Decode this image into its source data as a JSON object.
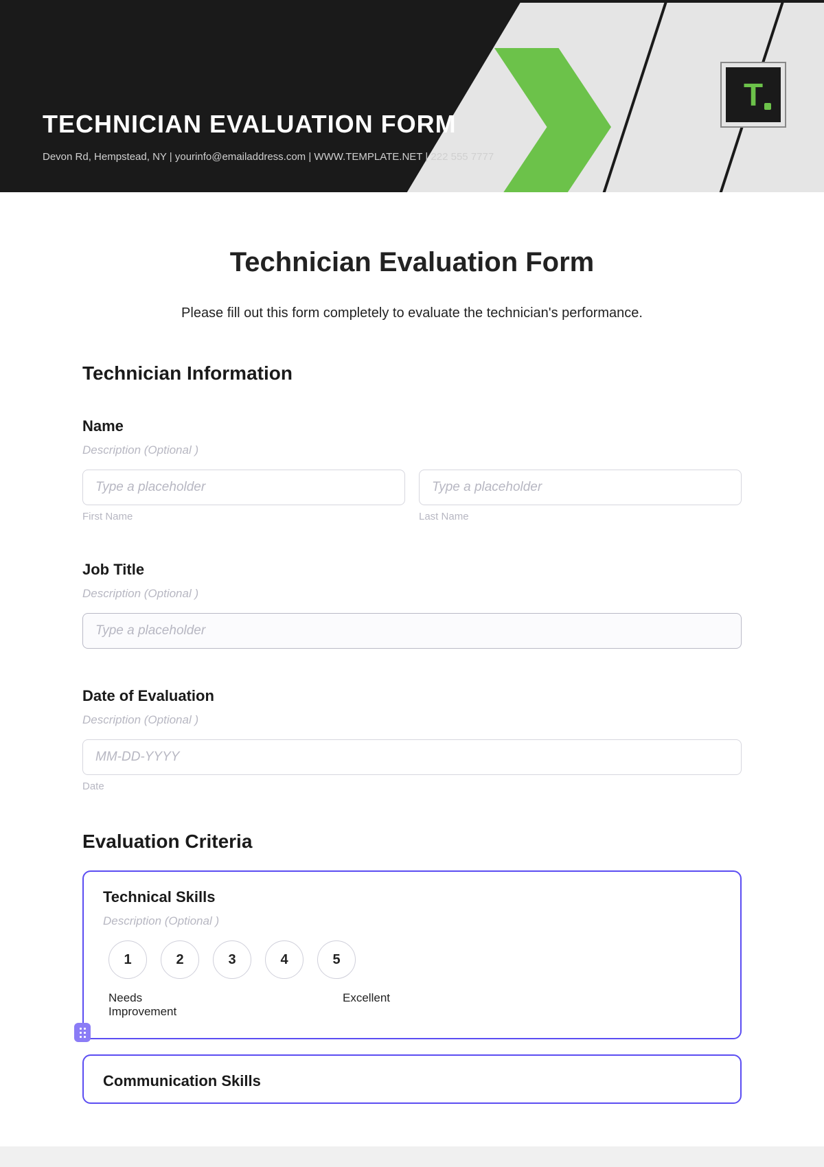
{
  "banner": {
    "title": "TECHNICIAN EVALUATION FORM",
    "subline": "Devon Rd, Hempstead, NY | yourinfo@emailaddress.com | WWW.TEMPLATE.NET | 222 555 7777",
    "logo_letter": "T"
  },
  "form": {
    "title": "Technician Evaluation Form",
    "intro": "Please fill out this form completely to evaluate the technician's performance."
  },
  "section1": {
    "heading": "Technician Information"
  },
  "name": {
    "label": "Name",
    "desc": "Description  (Optional )",
    "first_placeholder": "Type a placeholder",
    "last_placeholder": "Type a placeholder",
    "first_sub": "First Name",
    "last_sub": "Last Name"
  },
  "job": {
    "label": "Job Title",
    "desc": "Description  (Optional )",
    "placeholder": "Type a placeholder"
  },
  "date": {
    "label": "Date of Evaluation",
    "desc": "Description  (Optional )",
    "placeholder": "MM-DD-YYYY",
    "sub": "Date"
  },
  "section2": {
    "heading": "Evaluation Criteria"
  },
  "tech": {
    "label": "Technical Skills",
    "desc": "Description  (Optional )",
    "scale": [
      "1",
      "2",
      "3",
      "4",
      "5"
    ],
    "low": "Needs Improvement",
    "high": "Excellent"
  },
  "comm": {
    "label": "Communication Skills"
  }
}
